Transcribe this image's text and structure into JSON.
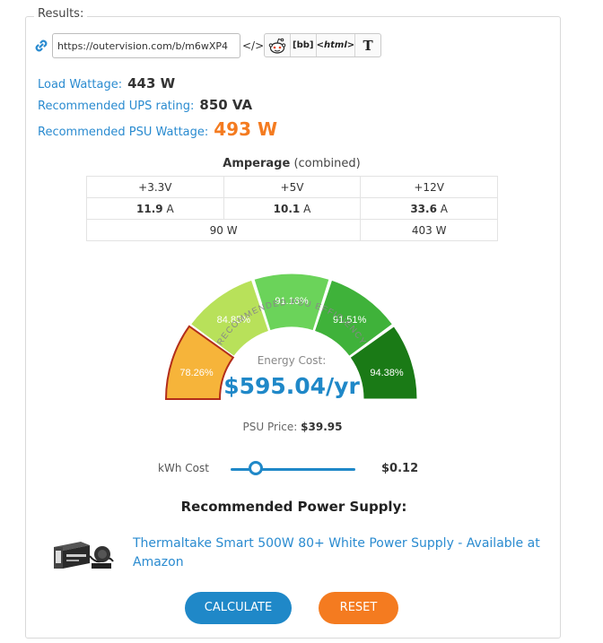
{
  "results": {
    "legend": "Results:",
    "share_url": "https://outervision.com/b/m6wXP4",
    "embed_label": "</>",
    "share_buttons": [
      {
        "icon": "reddit-icon",
        "label": ""
      },
      {
        "icon": "bbcode-icon",
        "label": "[bb]"
      },
      {
        "icon": "html-icon",
        "label": "<html>"
      },
      {
        "icon": "text-icon",
        "label": "T"
      }
    ]
  },
  "wattage": {
    "load_label": "Load Wattage:",
    "load_value": "443 W",
    "ups_label": "Recommended UPS rating:",
    "ups_value": "850 VA",
    "psu_label": "Recommended PSU Wattage:",
    "psu_value": "493 W"
  },
  "amperage": {
    "title": "Amperage",
    "subtitle": "(combined)",
    "rails": [
      "+3.3V",
      "+5V",
      "+12V"
    ],
    "currents": [
      {
        "value": "11.9",
        "unit": "A"
      },
      {
        "value": "10.1",
        "unit": "A"
      },
      {
        "value": "33.6",
        "unit": "A"
      }
    ],
    "watts": [
      "90 W",
      "403 W"
    ]
  },
  "efficiency_gauge": {
    "title": "RECOMMENDED PSU EFFICIENCY",
    "segments": [
      {
        "label": "78.26%",
        "color": "#f6b43a",
        "selected": true
      },
      {
        "label": "84.85%",
        "color": "#b8e15a",
        "selected": false
      },
      {
        "label": "91.16%",
        "color": "#6bd35a",
        "selected": false
      },
      {
        "label": "91.51%",
        "color": "#3fb23a",
        "selected": false
      },
      {
        "label": "94.38%",
        "color": "#1a7a16",
        "selected": false
      }
    ],
    "energy_label": "Energy Cost:",
    "energy_value": "$595.04/yr"
  },
  "psu_price": {
    "label": "PSU Price:",
    "value": "$39.95"
  },
  "kwh": {
    "label": "kWh Cost",
    "value": "$0.12",
    "slider_fraction": 0.2
  },
  "recommendation": {
    "title": "Recommended Power Supply:",
    "product_link": "Thermaltake Smart 500W 80+ White Power Supply - Available at Amazon"
  },
  "buttons": {
    "calculate": "CALCULATE",
    "reset": "RESET"
  },
  "colors": {
    "accent_blue": "#1f88c8",
    "link_blue": "#2a8bd0",
    "accent_orange": "#f47b20"
  }
}
